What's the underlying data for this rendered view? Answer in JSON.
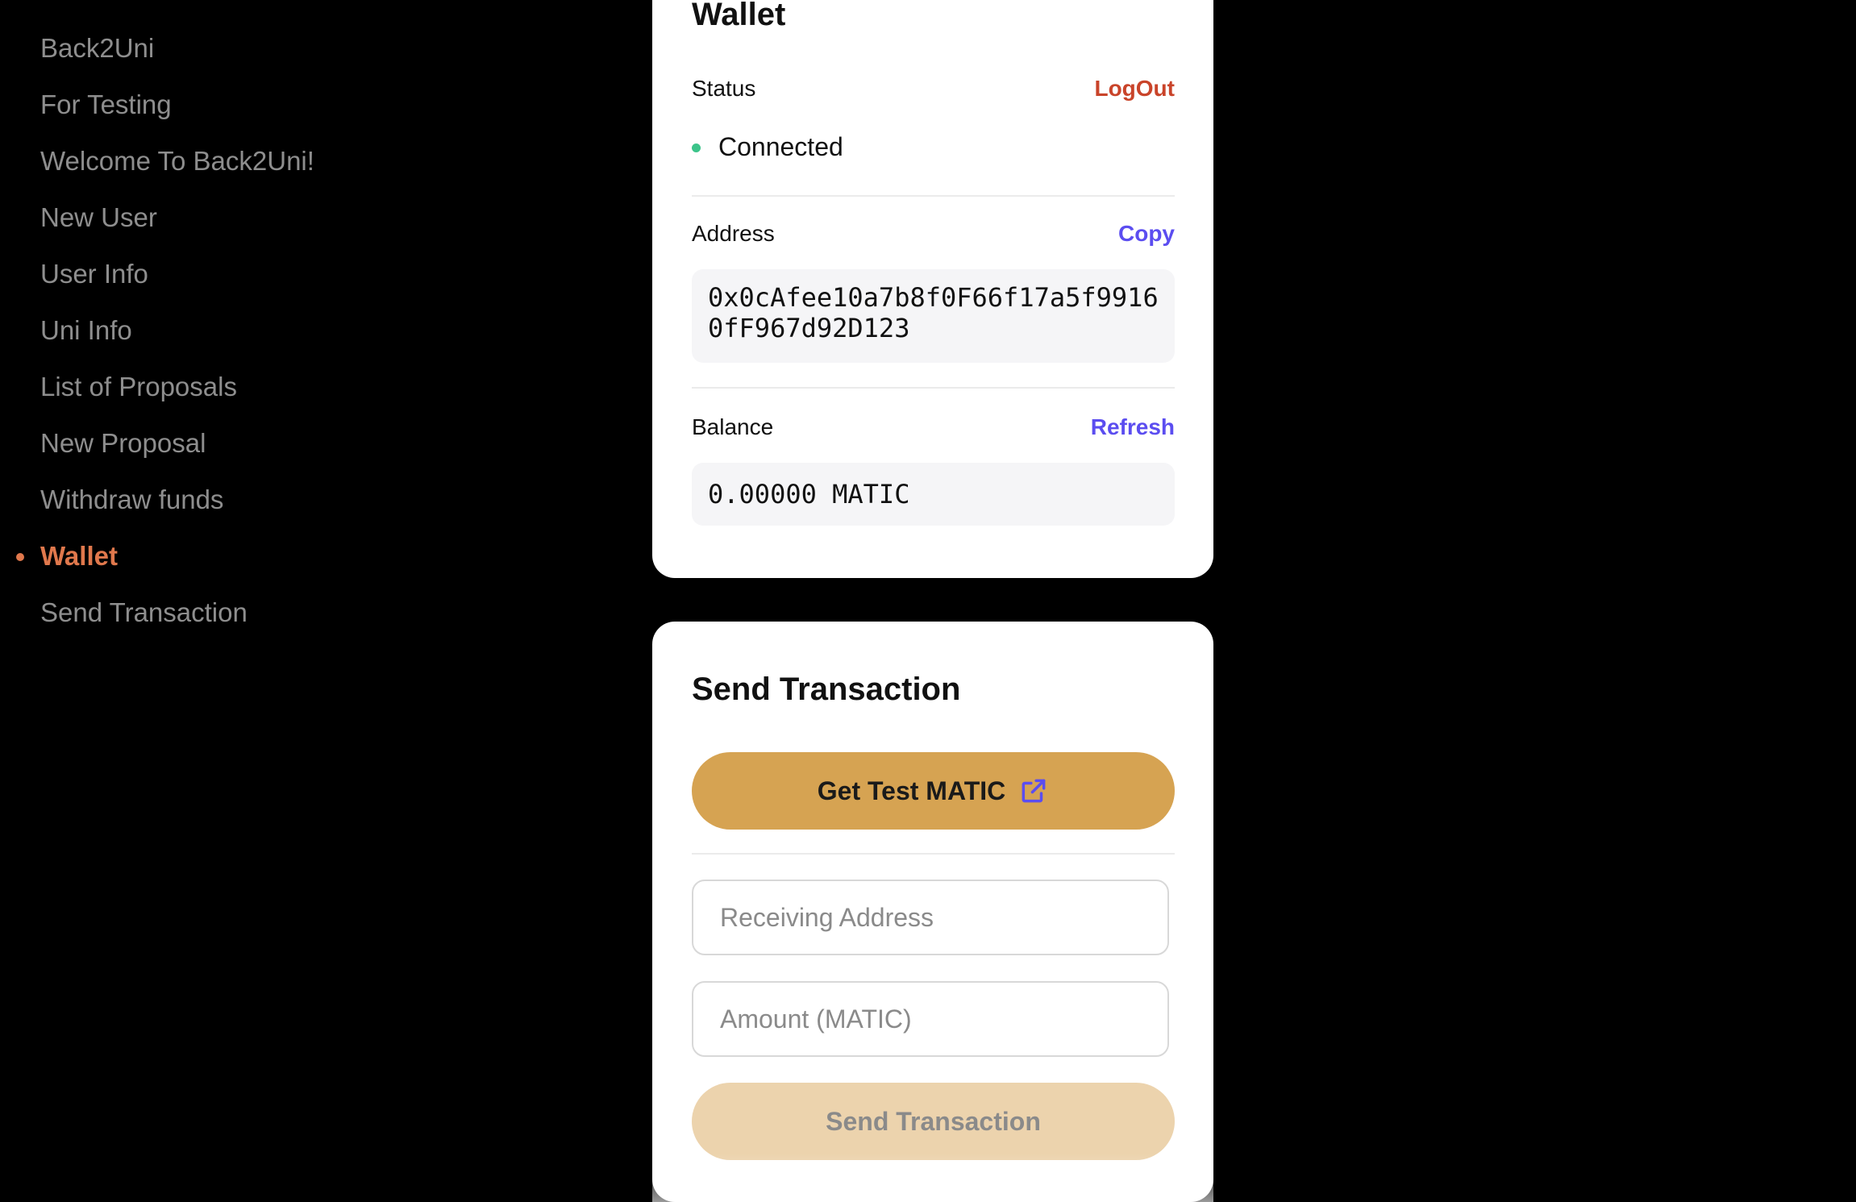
{
  "sidebar": {
    "items": [
      {
        "label": "Back2Uni"
      },
      {
        "label": "For Testing"
      },
      {
        "label": "Welcome To Back2Uni!"
      },
      {
        "label": "New User"
      },
      {
        "label": "User Info"
      },
      {
        "label": "Uni Info"
      },
      {
        "label": "List of Proposals"
      },
      {
        "label": "New Proposal"
      },
      {
        "label": "Withdraw funds"
      },
      {
        "label": "Wallet"
      },
      {
        "label": "Send Transaction"
      }
    ],
    "active": "Wallet",
    "active_color": "#e0784c"
  },
  "wallet": {
    "title": "Wallet",
    "status_label": "Status",
    "logout_label": "LogOut",
    "status_value": "Connected",
    "address_label": "Address",
    "copy_label": "Copy",
    "address_value": "0x0cAfee10a7b8f0F66f17a5f99160fF967d92D123",
    "balance_label": "Balance",
    "refresh_label": "Refresh",
    "balance_value": "0.00000 MATIC"
  },
  "send": {
    "title": "Send Transaction",
    "faucet_button": "Get Test MATIC",
    "faucet_icon": "external-link-icon",
    "receiving_placeholder": "Receiving Address",
    "amount_placeholder": "Amount (MATIC)",
    "submit_button": "Send Transaction"
  },
  "colors": {
    "background": "#000000",
    "accent_gold": "#d6a352",
    "link_purple": "#5b4df0",
    "logout_red": "#c9442a",
    "connected_green": "#3cc48a"
  }
}
